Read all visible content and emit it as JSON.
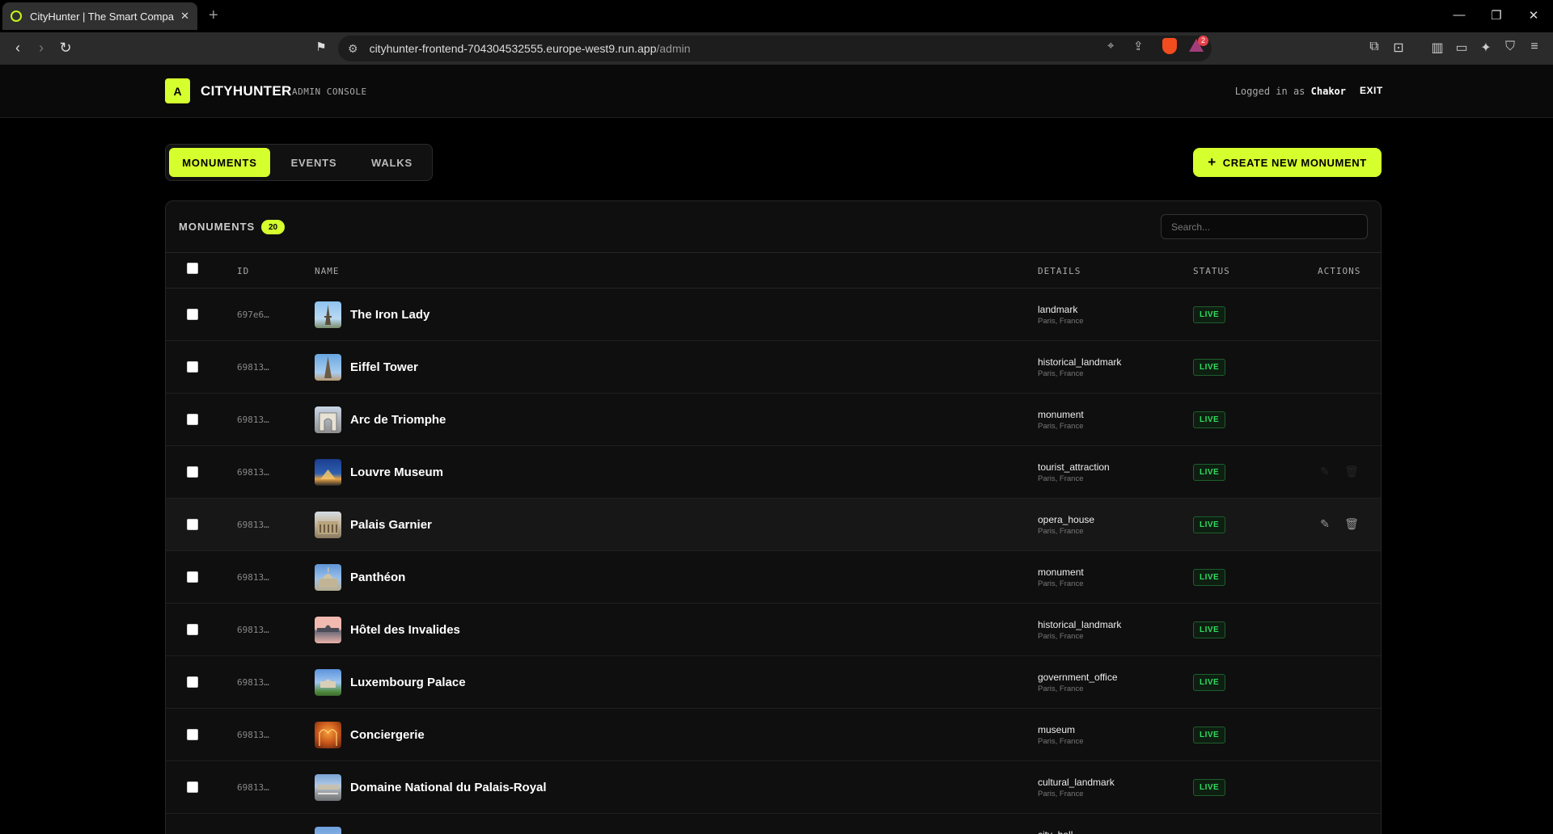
{
  "browser": {
    "tab_title": "CityHunter | The Smart Compass",
    "url_host": "cityhunter-frontend-704304532555.europe-west9.run.app",
    "url_path": "/admin",
    "notification_count": "2"
  },
  "header": {
    "logo_letter": "A",
    "brand": "CITYHUNTER",
    "subtitle": "ADMIN CONSOLE",
    "logged_prefix": "Logged in as",
    "username": "Chakor",
    "exit_label": "EXIT"
  },
  "tabs": [
    {
      "label": "MONUMENTS",
      "active": true
    },
    {
      "label": "EVENTS",
      "active": false
    },
    {
      "label": "WALKS",
      "active": false
    }
  ],
  "create_button": {
    "icon": "plus-icon",
    "label": "CREATE NEW MONUMENT"
  },
  "panel": {
    "title": "MONUMENTS",
    "count": "20",
    "search_placeholder": "Search..."
  },
  "table": {
    "columns": {
      "id": "ID",
      "name": "NAME",
      "details": "DETAILS",
      "status": "STATUS",
      "actions": "ACTIONS"
    },
    "rows": [
      {
        "id": "697e6…",
        "name": "The Iron Lady",
        "category": "landmark",
        "location": "Paris, France",
        "status": "LIVE"
      },
      {
        "id": "69813…",
        "name": "Eiffel Tower",
        "category": "historical_landmark",
        "location": "Paris, France",
        "status": "LIVE"
      },
      {
        "id": "69813…",
        "name": "Arc de Triomphe",
        "category": "monument",
        "location": "Paris, France",
        "status": "LIVE"
      },
      {
        "id": "69813…",
        "name": "Louvre Museum",
        "category": "tourist_attraction",
        "location": "Paris, France",
        "status": "LIVE"
      },
      {
        "id": "69813…",
        "name": "Palais Garnier",
        "category": "opera_house",
        "location": "Paris, France",
        "status": "LIVE"
      },
      {
        "id": "69813…",
        "name": "Panthéon",
        "category": "monument",
        "location": "Paris, France",
        "status": "LIVE"
      },
      {
        "id": "69813…",
        "name": "Hôtel des Invalides",
        "category": "historical_landmark",
        "location": "Paris, France",
        "status": "LIVE"
      },
      {
        "id": "69813…",
        "name": "Luxembourg Palace",
        "category": "government_office",
        "location": "Paris, France",
        "status": "LIVE"
      },
      {
        "id": "69813…",
        "name": "Conciergerie",
        "category": "museum",
        "location": "Paris, France",
        "status": "LIVE"
      },
      {
        "id": "69813…",
        "name": "Domaine National du Palais-Royal",
        "category": "cultural_landmark",
        "location": "Paris, France",
        "status": "LIVE"
      },
      {
        "id": "",
        "name": "",
        "category": "city_hall",
        "location": "",
        "status": ""
      }
    ]
  },
  "colors": {
    "accent": "#d6ff2e",
    "live_text": "#2fdc5c",
    "background": "#000000"
  }
}
